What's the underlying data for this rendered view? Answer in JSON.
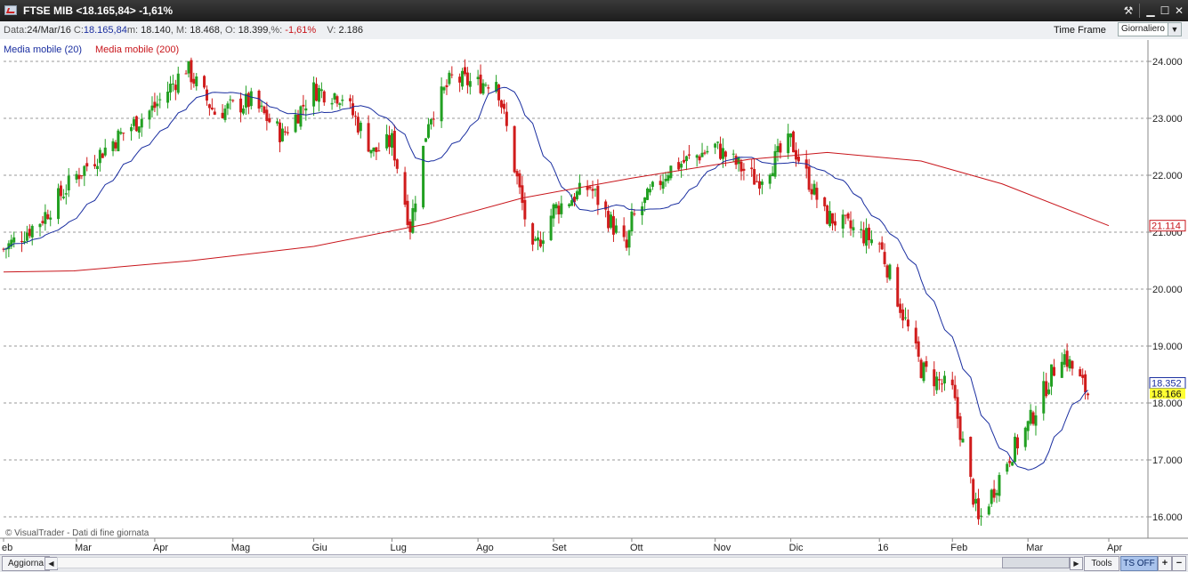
{
  "window": {
    "title": "FTSE MIB <18.165,84> -1,61%",
    "buttons": {
      "tool": "⚒",
      "minimize": "▁",
      "maximize": "☐",
      "close": "✕"
    }
  },
  "info": {
    "data_label": "Data:",
    "data_value": "24/Mar/16",
    "close_label": "C:",
    "close_value": "18.165,84",
    "min_label": "m:",
    "min_value": "18.140",
    "max_label": "M:",
    "max_value": "18.468",
    "open_label": "O:",
    "open_value": "18.399",
    "pct_label": "%:",
    "pct_value": "-1,61%",
    "vol_label": "V:",
    "vol_value": "2.186",
    "timeframe_label": "Time Frame",
    "timeframe_value": "Giornaliero"
  },
  "legend": {
    "ma20": "Media mobile (20)",
    "ma200": "Media mobile (200)"
  },
  "copyright": "© VisualTrader - Dati di fine giornata",
  "bottombar": {
    "aggiorna": "Aggiorna",
    "tools": "Tools",
    "ts_off": "TS OFF",
    "plus": "+",
    "minus": "−",
    "scroll_left": "◀",
    "scroll_right": "▶"
  },
  "colors": {
    "up": "#22a022",
    "down": "#d01c1c",
    "ma20": "#1a2ea0",
    "ma200": "#c8151b",
    "last_price_bg": "#ffff33"
  },
  "chart_data": {
    "type": "candlestick",
    "ylim": [
      15600,
      24400
    ],
    "y_ticks": [
      16000,
      17000,
      18000,
      19000,
      20000,
      21000,
      22000,
      23000,
      24000
    ],
    "y_tick_labels": [
      "16.000",
      "17.000",
      "18.000",
      "19.000",
      "20.000",
      "21.000",
      "22.000",
      "23.000",
      "24.000"
    ],
    "x_labels": [
      {
        "label": "eb",
        "date": "2015-02-02"
      },
      {
        "label": "Mar",
        "date": "2015-03-02"
      },
      {
        "label": "Apr",
        "date": "2015-04-01"
      },
      {
        "label": "Mag",
        "date": "2015-05-01"
      },
      {
        "label": "Giu",
        "date": "2015-06-01"
      },
      {
        "label": "Lug",
        "date": "2015-07-01"
      },
      {
        "label": "Ago",
        "date": "2015-08-03"
      },
      {
        "label": "Set",
        "date": "2015-09-01"
      },
      {
        "label": "Ott",
        "date": "2015-10-01"
      },
      {
        "label": "Nov",
        "date": "2015-11-02"
      },
      {
        "label": "Dic",
        "date": "2015-12-01"
      },
      {
        "label": "16",
        "date": "2016-01-04"
      },
      {
        "label": "Feb",
        "date": "2016-02-01"
      },
      {
        "label": "Mar",
        "date": "2016-03-01"
      },
      {
        "label": "Apr",
        "date": "2016-04-01"
      }
    ],
    "series": [
      {
        "name": "Prezzo",
        "values": [
          {
            "date": "2015-02-02",
            "close": 20700
          },
          {
            "date": "2015-02-16",
            "close": 21200
          },
          {
            "date": "2015-03-02",
            "close": 22000
          },
          {
            "date": "2015-03-16",
            "close": 22600
          },
          {
            "date": "2015-04-01",
            "close": 23200
          },
          {
            "date": "2015-04-13",
            "close": 23900
          },
          {
            "date": "2015-04-24",
            "close": 23100
          },
          {
            "date": "2015-05-08",
            "close": 23300
          },
          {
            "date": "2015-05-20",
            "close": 22700
          },
          {
            "date": "2015-06-01",
            "close": 23500
          },
          {
            "date": "2015-06-12",
            "close": 23400
          },
          {
            "date": "2015-06-24",
            "close": 22400
          },
          {
            "date": "2015-07-01",
            "close": 22600
          },
          {
            "date": "2015-07-08",
            "close": 21100
          },
          {
            "date": "2015-07-15",
            "close": 23000
          },
          {
            "date": "2015-07-24",
            "close": 23700
          },
          {
            "date": "2015-08-03",
            "close": 23600
          },
          {
            "date": "2015-08-10",
            "close": 23700
          },
          {
            "date": "2015-08-24",
            "close": 20600
          },
          {
            "date": "2015-09-01",
            "close": 21400
          },
          {
            "date": "2015-09-15",
            "close": 21800
          },
          {
            "date": "2015-09-29",
            "close": 20700
          },
          {
            "date": "2015-10-01",
            "close": 21200
          },
          {
            "date": "2015-10-15",
            "close": 22100
          },
          {
            "date": "2015-11-02",
            "close": 22500
          },
          {
            "date": "2015-11-18",
            "close": 21900
          },
          {
            "date": "2015-12-01",
            "close": 22600
          },
          {
            "date": "2015-12-14",
            "close": 21300
          },
          {
            "date": "2016-01-04",
            "close": 20800
          },
          {
            "date": "2016-01-20",
            "close": 18600
          },
          {
            "date": "2016-02-01",
            "close": 18200
          },
          {
            "date": "2016-02-11",
            "close": 15900
          },
          {
            "date": "2016-02-22",
            "close": 17000
          },
          {
            "date": "2016-03-01",
            "close": 17600
          },
          {
            "date": "2016-03-14",
            "close": 18900
          },
          {
            "date": "2016-03-24",
            "close": 18166
          }
        ]
      },
      {
        "name": "Media mobile (20)",
        "last_value": "18.352"
      },
      {
        "name": "Media mobile (200)",
        "last_value": "21.114"
      }
    ],
    "last_price": "18.166",
    "grid": true
  }
}
